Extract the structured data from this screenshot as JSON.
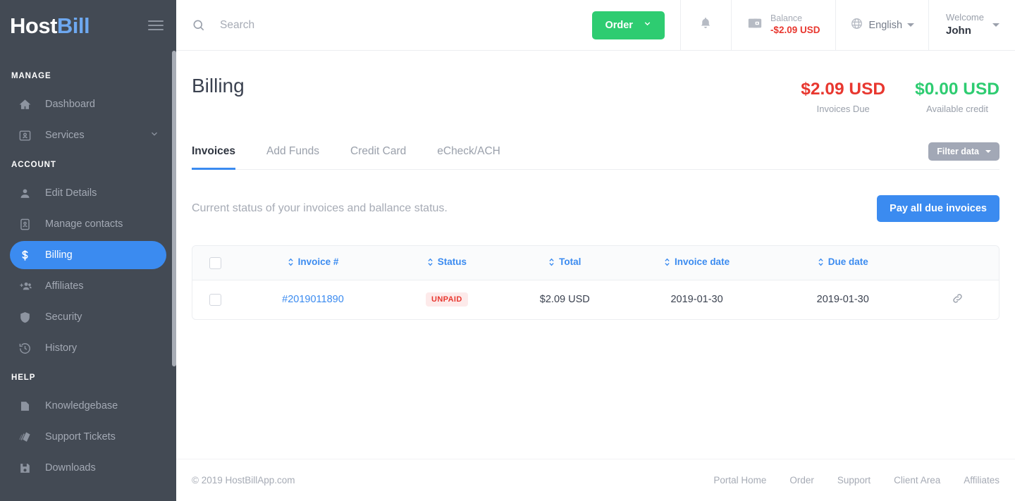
{
  "sidebar": {
    "logo_white": "Host",
    "logo_blue": "Bill",
    "sections": [
      {
        "title": "MANAGE",
        "items": [
          {
            "label": "Dashboard",
            "icon": "home-icon",
            "active": false,
            "chevron": false
          },
          {
            "label": "Services",
            "icon": "user-card-icon",
            "active": false,
            "chevron": true
          }
        ]
      },
      {
        "title": "ACCOUNT",
        "items": [
          {
            "label": "Edit Details",
            "icon": "person-icon",
            "active": false,
            "chevron": false
          },
          {
            "label": "Manage contacts",
            "icon": "contacts-icon",
            "active": false,
            "chevron": false
          },
          {
            "label": "Billing",
            "icon": "dollar-icon",
            "active": true,
            "chevron": false
          },
          {
            "label": "Affiliates",
            "icon": "add-people-icon",
            "active": false,
            "chevron": false
          },
          {
            "label": "Security",
            "icon": "shield-icon",
            "active": false,
            "chevron": false
          },
          {
            "label": "History",
            "icon": "history-clock-icon",
            "active": false,
            "chevron": false
          }
        ]
      },
      {
        "title": "HELP",
        "items": [
          {
            "label": "Knowledgebase",
            "icon": "document-icon",
            "active": false,
            "chevron": false
          },
          {
            "label": "Support Tickets",
            "icon": "tickets-icon",
            "active": false,
            "chevron": false
          },
          {
            "label": "Downloads",
            "icon": "floppy-disk-icon",
            "active": false,
            "chevron": false
          }
        ]
      }
    ]
  },
  "topbar": {
    "search_placeholder": "Search",
    "search_value": "",
    "order_label": "Order",
    "balance_label": "Balance",
    "balance_value": "-$2.09 USD",
    "language": "English",
    "welcome_label": "Welcome",
    "user_name": "John"
  },
  "page": {
    "title": "Billing",
    "stats": [
      {
        "value": "$2.09 USD",
        "label": "Invoices Due",
        "color": "#e8372f"
      },
      {
        "value": "$0.00 USD",
        "label": "Available credit",
        "color": "#2ecc71"
      }
    ],
    "tabs": [
      {
        "label": "Invoices",
        "active": true
      },
      {
        "label": "Add Funds",
        "active": false
      },
      {
        "label": "Credit Card",
        "active": false
      },
      {
        "label": "eCheck/ACH",
        "active": false
      }
    ],
    "filter_label": "Filter data",
    "description": "Current status of your invoices and ballance status.",
    "pay_all_label": "Pay all due invoices"
  },
  "table": {
    "columns": [
      "Invoice #",
      "Status",
      "Total",
      "Invoice date",
      "Due date"
    ],
    "rows": [
      {
        "invoice": "#2019011890",
        "status": "UNPAID",
        "total": "$2.09 USD",
        "invoice_date": "2019-01-30",
        "due_date": "2019-01-30"
      }
    ]
  },
  "footer": {
    "copyright": "© 2019 HostBillApp.com",
    "links": [
      "Portal Home",
      "Order",
      "Support",
      "Client Area",
      "Affiliates"
    ]
  },
  "colors": {
    "accent_blue": "#3b8bf0",
    "green": "#2ecc71",
    "red": "#e8372f",
    "sidebar_bg": "#434a54"
  }
}
